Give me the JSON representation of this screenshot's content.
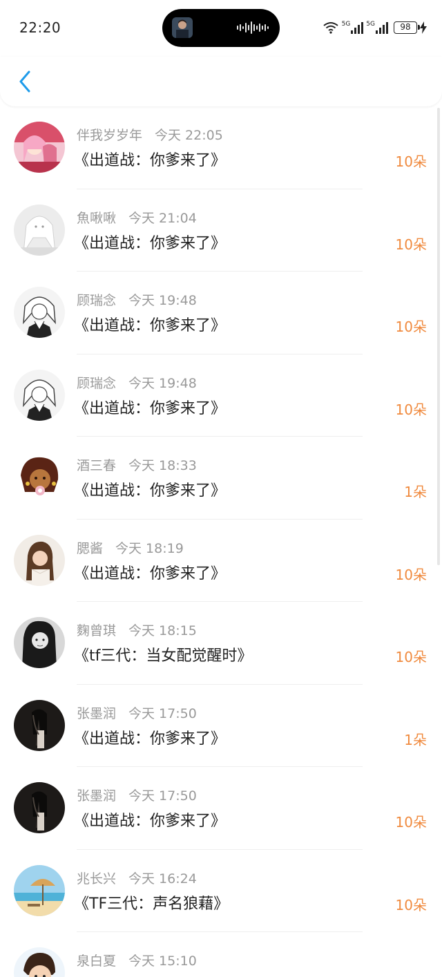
{
  "status_bar": {
    "time": "22:20",
    "network_1": "5G",
    "network_2": "5G",
    "battery": "98"
  },
  "header": {
    "back_icon": "chevron-left-icon",
    "accent_color": "#1e9bea"
  },
  "gifts": [
    {
      "user": "伴我岁岁年",
      "time": "今天 22:05",
      "title": "《出道战：你爹来了》",
      "amount": "10朵",
      "avatar": "anime-pink"
    },
    {
      "user": "魚啾啾",
      "time": "今天 21:04",
      "title": "《出道战：你爹来了》",
      "amount": "10朵",
      "avatar": "anime-white"
    },
    {
      "user": "顾瑞念",
      "time": "今天 19:48",
      "title": "《出道战：你爹来了》",
      "amount": "10朵",
      "avatar": "manga-bw"
    },
    {
      "user": "顾瑞念",
      "time": "今天 19:48",
      "title": "《出道战：你爹来了》",
      "amount": "10朵",
      "avatar": "manga-bw"
    },
    {
      "user": "酒三春",
      "time": "今天 18:33",
      "title": "《出道战：你爹来了》",
      "amount": "1朵",
      "avatar": "cartoon-brown"
    },
    {
      "user": "腮酱",
      "time": "今天 18:19",
      "title": "《出道战：你爹来了》",
      "amount": "10朵",
      "avatar": "photo-woman"
    },
    {
      "user": "麴曾琪",
      "time": "今天 18:15",
      "title": "《tf三代：当女配觉醒时》",
      "amount": "10朵",
      "avatar": "photo-bw"
    },
    {
      "user": "张墨润",
      "time": "今天 17:50",
      "title": "《出道战：你爹来了》",
      "amount": "1朵",
      "avatar": "photo-dark"
    },
    {
      "user": "张墨润",
      "time": "今天 17:50",
      "title": "《出道战：你爹来了》",
      "amount": "10朵",
      "avatar": "photo-dark"
    },
    {
      "user": "兆长兴",
      "time": "今天 16:24",
      "title": "《TF三代：声名狼藉》",
      "amount": "10朵",
      "avatar": "beach-umbrella"
    },
    {
      "user": "泉白夏",
      "time": "今天 15:10",
      "title": "",
      "amount": "",
      "avatar": "cartoon-boy"
    }
  ],
  "colors": {
    "amount": "#f08a3e",
    "meta": "#999999",
    "title": "#222222"
  }
}
